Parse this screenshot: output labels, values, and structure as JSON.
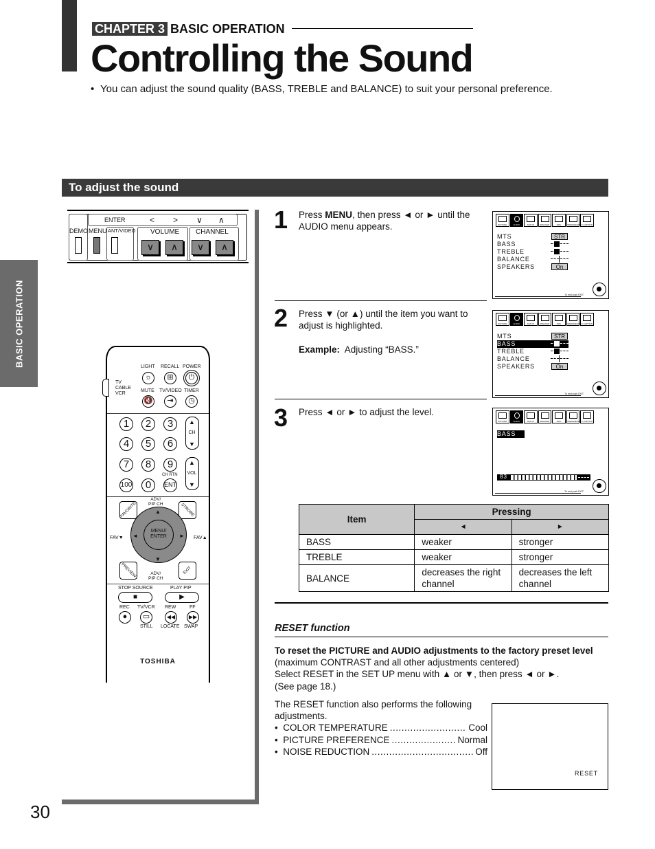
{
  "header": {
    "chapter_label": "CHAPTER 3",
    "chapter_title": "BASIC OPERATION",
    "page_title": "Controlling the Sound",
    "intro_bullet": "•",
    "intro_text": "You can adjust the sound quality (BASS, TREBLE and BALANCE) to suit your personal preference."
  },
  "section_title": "To adjust the sound",
  "side_tab": "BASIC OPERATION",
  "page_number": "30",
  "front_panel": {
    "enter": "ENTER",
    "arrows": [
      "<",
      ">",
      "∨",
      "∧"
    ],
    "demo": "DEMO",
    "menu": "MENU",
    "ant_video": "ANT/VIDEO",
    "volume": "VOLUME",
    "channel": "CHANNEL"
  },
  "remote": {
    "row1_labels": [
      "LIGHT",
      "RECALL",
      "POWER"
    ],
    "row2_labels": [
      "MUTE",
      "TV/VIDEO",
      "TIMER"
    ],
    "switch_labels": [
      "TV",
      "CABLE",
      "VCR"
    ],
    "numbers": [
      "1",
      "2",
      "3",
      "4",
      "5",
      "6",
      "7",
      "8",
      "9",
      "100",
      "0",
      "ENT"
    ],
    "ch": "CH",
    "vol": "VOL",
    "ch_rtn": "CH RTN",
    "adv_pip": "ADV/\nPIP CH",
    "favorite": "FAVORITE",
    "strobe": "STROBE",
    "preview": "PREVIEW",
    "exit": "EXIT",
    "fav_down": "FAV▼",
    "fav_up": "FAV▲",
    "menu_enter": "MENU/\nENTER",
    "stop_source": "STOP SOURCE",
    "play_pip": "PLAY PIP",
    "rec": "REC",
    "tv_vcr": "TV/VCR",
    "rew": "REW",
    "ff": "FF",
    "still": "STILL",
    "locate": "LOCATE",
    "swap": "SWAP",
    "brand": "TOSHIBA"
  },
  "steps": [
    {
      "num": "1",
      "pre": "Press ",
      "bold": "MENU",
      "post": ", then press ◄ or ► until the AUDIO menu appears."
    },
    {
      "num": "2",
      "text": "Press ▼ (or ▲) until the item you want to adjust is highlighted.",
      "example_label": "Example:",
      "example_text": "Adjusting “BASS.”"
    },
    {
      "num": "3",
      "text": "Press ◄ or ► to adjust the level."
    }
  ],
  "osd": {
    "icons": [
      "PICTURE",
      "AUDIO",
      "SETUP",
      "SPEAKER",
      "SRS",
      "PREFERENCE",
      "C.CAPTION"
    ],
    "items": [
      "MTS",
      "BASS",
      "TREBLE",
      "BALANCE",
      "SPEAKERS"
    ],
    "mts_value": "STR",
    "speakers_value": "On",
    "exit_note": "To end push EXIT",
    "bass_label": "BASS",
    "bass_level": "83"
  },
  "table": {
    "head_item": "Item",
    "head_pressing": "Pressing",
    "left": "◄",
    "right": "►",
    "rows": [
      {
        "item": "BASS",
        "left": "weaker",
        "right": "stronger"
      },
      {
        "item": "TREBLE",
        "left": "weaker",
        "right": "stronger"
      },
      {
        "item": "BALANCE",
        "left": "decreases the right channel",
        "right": "decreases the left channel"
      }
    ]
  },
  "reset": {
    "heading": "RESET function",
    "lead_bold": "To reset the PICTURE and AUDIO adjustments to the factory preset level",
    "line2": "(maximum CONTRAST and all other adjustments centered)",
    "line3": "Select RESET in the SET UP menu with ▲ or ▼, then press ◄ or ►.",
    "line4": "(See page 18.)",
    "extra_intro": "The RESET function also performs the following adjustments.",
    "list": [
      {
        "key": "COLOR TEMPERATURE",
        "value": "Cool"
      },
      {
        "key": "PICTURE PREFERENCE",
        "value": "Normal"
      },
      {
        "key": "NOISE REDUCTION",
        "value": "Off"
      }
    ],
    "screen_label": "RESET"
  }
}
